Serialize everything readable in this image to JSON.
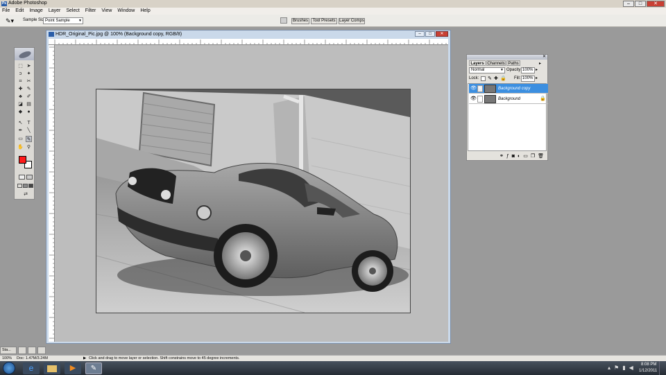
{
  "app": {
    "title": "Adobe Photoshop"
  },
  "menu": [
    "File",
    "Edit",
    "Image",
    "Layer",
    "Select",
    "Filter",
    "View",
    "Window",
    "Help"
  ],
  "options": {
    "sample_size_label": "Sample Size:",
    "sample_size_value": "Point Sample"
  },
  "wells": [
    "Brushes",
    "Tool Presets",
    "Layer Comps"
  ],
  "document": {
    "title": "HDR_Original_Pic.jpg @ 100% (Background copy, RGB/8)"
  },
  "layers_panel": {
    "tabs": [
      "Layers",
      "Channels",
      "Paths"
    ],
    "blend_mode": "Normal",
    "opacity_label": "Opacity:",
    "opacity_value": "100%",
    "lock_label": "Lock:",
    "fill_label": "Fill:",
    "fill_value": "100%",
    "layers": [
      {
        "name": "Background copy",
        "selected": true
      },
      {
        "name": "Background",
        "selected": false
      }
    ]
  },
  "toolbox": {
    "foreground_color": "#ff1a1a",
    "background_color": "#ffffff"
  },
  "minimized": {
    "label": "Sta..."
  },
  "status": {
    "zoom": "100%",
    "doc": "Doc: 1.47M/3.24M",
    "hint": "Click and drag to move layer or selection. Shift constrains move to 45 degree increments."
  },
  "taskbar": {
    "time": "8:08 PM",
    "date": "1/12/2011"
  },
  "colors": {
    "accent": "#3c8fe0",
    "titlebar": "#d8d2c7",
    "workspace": "#9a9a9a"
  }
}
